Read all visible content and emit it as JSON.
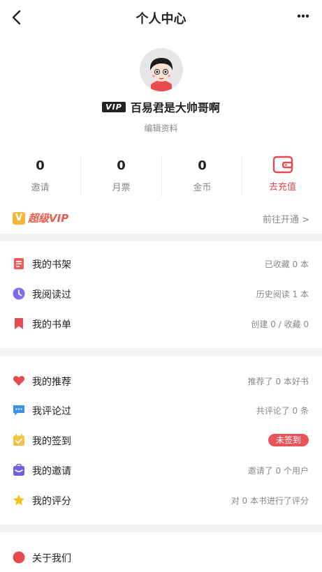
{
  "header": {
    "title": "个人中心"
  },
  "profile": {
    "vip_badge": "VIP",
    "username": "百易君是大帅哥啊",
    "edit_label": "编辑资料"
  },
  "stats": [
    {
      "value": "0",
      "label": "邀请"
    },
    {
      "value": "0",
      "label": "月票"
    },
    {
      "value": "0",
      "label": "金币"
    }
  ],
  "recharge": {
    "label": "去充值"
  },
  "super_vip": {
    "logo_letter": "V",
    "title": "超级VIP",
    "link": "前往开通 >"
  },
  "section1": [
    {
      "icon": "bookshelf-icon",
      "label": "我的书架",
      "meta": "已收藏 0 本"
    },
    {
      "icon": "clock-icon",
      "label": "我阅读过",
      "meta": "历史阅读 1 本"
    },
    {
      "icon": "bookmark-icon",
      "label": "我的书单",
      "meta": "创建 0 / 收藏 0"
    }
  ],
  "section2": [
    {
      "icon": "heart-icon",
      "label": "我的推荐",
      "meta": "推荐了 0 本好书"
    },
    {
      "icon": "comment-icon",
      "label": "我评论过",
      "meta": "共评论了 0 条"
    },
    {
      "icon": "calendar-check-icon",
      "label": "我的签到",
      "badge": "未签到"
    },
    {
      "icon": "invite-icon",
      "label": "我的邀请",
      "meta": "邀请了 0 个用户"
    },
    {
      "icon": "star-icon",
      "label": "我的评分",
      "meta": "对 0 本书进行了评分"
    }
  ],
  "section3": [
    {
      "icon": "info-icon",
      "label": "关于我们"
    }
  ],
  "colors": {
    "accent_red": "#e5494f",
    "vip_gold": "#f6b739",
    "separator": "#f2f2f4"
  }
}
